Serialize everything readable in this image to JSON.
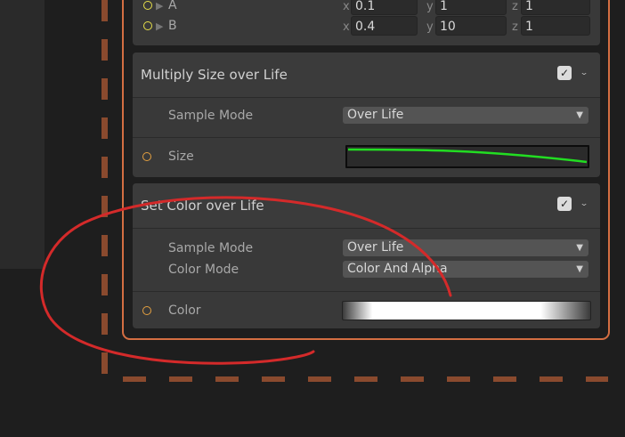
{
  "top_params": [
    {
      "label": "A",
      "x": "0.1",
      "y": "1",
      "z": "1"
    },
    {
      "label": "B",
      "x": "0.4",
      "y": "10",
      "z": "1"
    }
  ],
  "axis_labels": {
    "x": "x",
    "y": "y",
    "z": "z"
  },
  "size_block": {
    "title": "Multiply Size over Life",
    "sample_mode_label": "Sample Mode",
    "sample_mode_value": "Over Life",
    "size_label": "Size"
  },
  "color_block": {
    "title": "Set Color over Life",
    "sample_mode_label": "Sample Mode",
    "sample_mode_value": "Over Life",
    "color_mode_label": "Color Mode",
    "color_mode_value": "Color And Alpha",
    "color_label": "Color"
  },
  "glyphs": {
    "check": "✓",
    "chevron": "⌄",
    "dropdown": "▼",
    "expand": "▶"
  },
  "colors": {
    "node_border": "#d46e42",
    "curve": "#22dd22",
    "annotation": "#d42a2a",
    "port": "#e4a040",
    "port_vector": "#e8e04a"
  }
}
